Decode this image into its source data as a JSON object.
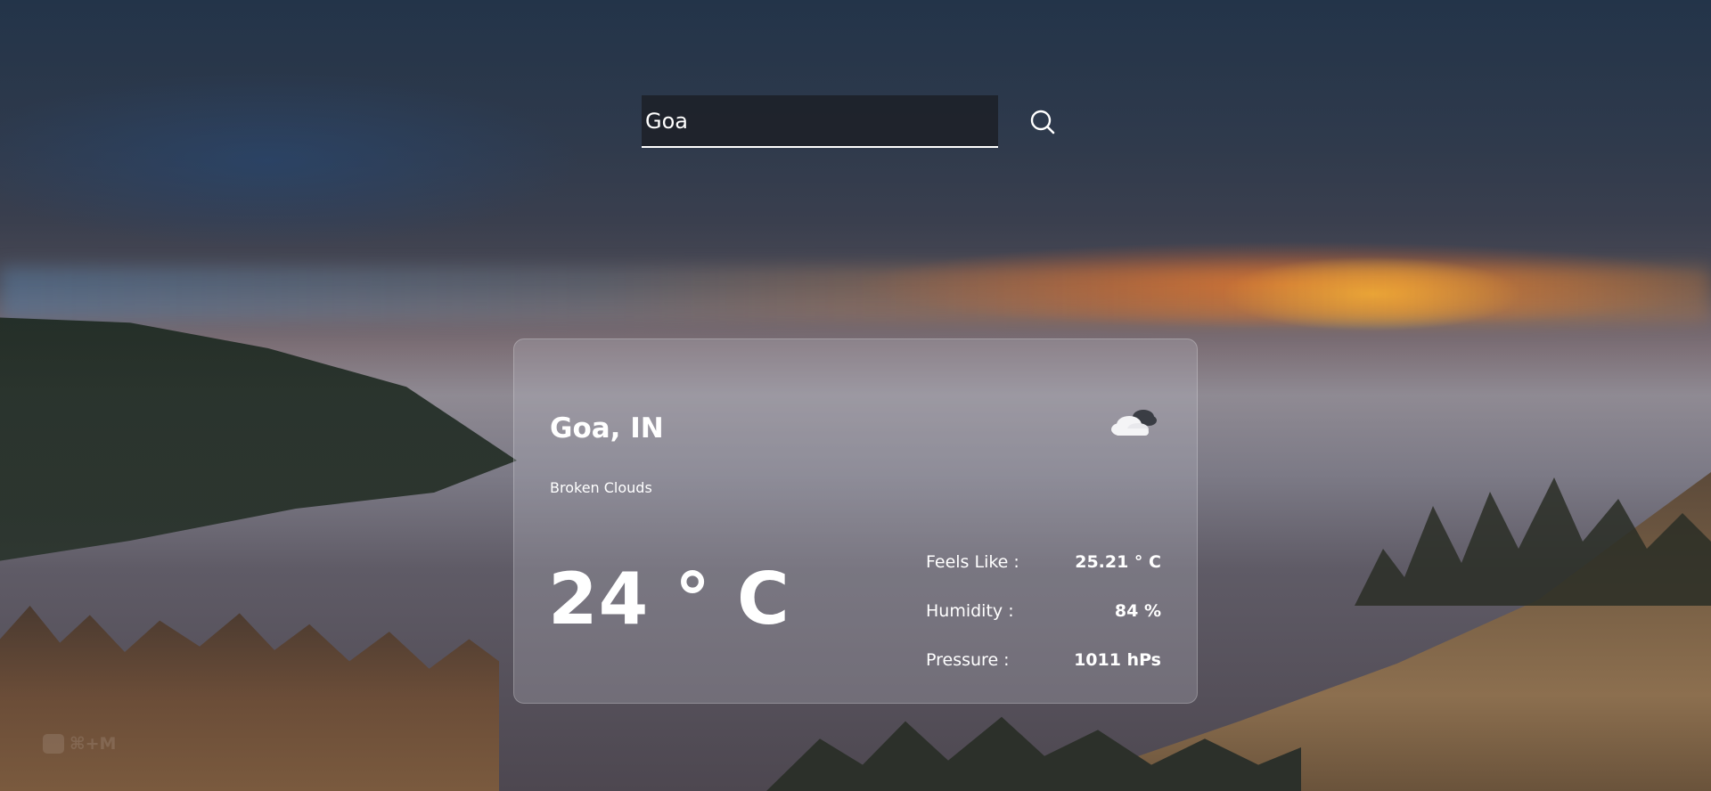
{
  "search": {
    "value": "Goa",
    "icon": "search-icon"
  },
  "weather": {
    "location": "Goa, IN",
    "description": "Broken Clouds",
    "icon": "cloud-icon",
    "temperature": "24 ° C",
    "stats": [
      {
        "label": "Feels Like :",
        "value": "25.21 ° C"
      },
      {
        "label": "Humidity :",
        "value": "84 %"
      },
      {
        "label": "Pressure :",
        "value": "1011 hPs"
      }
    ]
  },
  "watermark": {
    "shortcut": "⌘+M"
  }
}
